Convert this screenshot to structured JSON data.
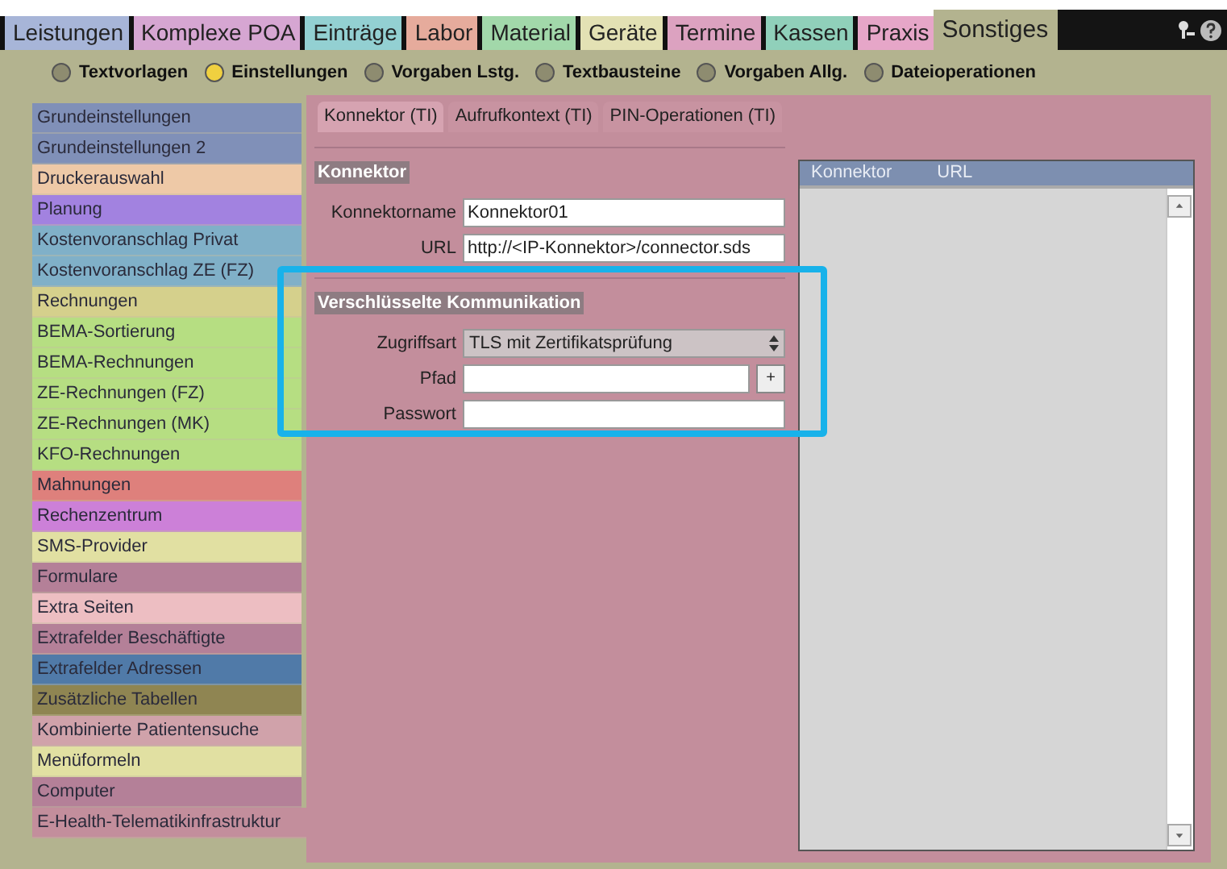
{
  "top_tabs": [
    {
      "label": "Leistungen",
      "color": "#a7b5d8",
      "selected": false
    },
    {
      "label": "Komplexe POA",
      "color": "#d6a6d2",
      "selected": false
    },
    {
      "label": "Einträge",
      "color": "#93d0d2",
      "selected": false
    },
    {
      "label": "Labor",
      "color": "#e6ab9c",
      "selected": false
    },
    {
      "label": "Material",
      "color": "#a2d8aa",
      "selected": false
    },
    {
      "label": "Geräte",
      "color": "#e3e1b4",
      "selected": false
    },
    {
      "label": "Termine",
      "color": "#dca2c0",
      "selected": false
    },
    {
      "label": "Kassen",
      "color": "#90d0ba",
      "selected": false
    },
    {
      "label": "Praxis",
      "color": "#e6a6c8",
      "selected": false
    },
    {
      "label": "Sonstiges",
      "color": "#b3b38f",
      "selected": true
    }
  ],
  "radio_options": [
    {
      "label": "Textvorlagen",
      "selected": false
    },
    {
      "label": "Einstellungen",
      "selected": true
    },
    {
      "label": "Vorgaben Lstg.",
      "selected": false
    },
    {
      "label": "Textbausteine",
      "selected": false
    },
    {
      "label": "Vorgaben Allg.",
      "selected": false
    },
    {
      "label": "Dateioperationen",
      "selected": false
    }
  ],
  "sidebar": {
    "items": [
      {
        "label": "Grundeinstellungen",
        "color": "#8090b8",
        "selected": false
      },
      {
        "label": "Grundeinstellungen 2",
        "color": "#8090b8",
        "selected": false
      },
      {
        "label": "Druckerauswahl",
        "color": "#eec9a7",
        "selected": false
      },
      {
        "label": "Planung",
        "color": "#a282e0",
        "selected": false
      },
      {
        "label": "Kostenvoranschlag Privat",
        "color": "#80b0c8",
        "selected": false
      },
      {
        "label": "Kostenvoranschlag ZE (FZ)",
        "color": "#80b0c8",
        "selected": false
      },
      {
        "label": "Rechnungen",
        "color": "#d5d08c",
        "selected": false
      },
      {
        "label": "BEMA-Sortierung",
        "color": "#b6de82",
        "selected": false
      },
      {
        "label": "BEMA-Rechnungen",
        "color": "#b6de82",
        "selected": false
      },
      {
        "label": "ZE-Rechnungen (FZ)",
        "color": "#b6de82",
        "selected": false
      },
      {
        "label": "ZE-Rechnungen (MK)",
        "color": "#b6de82",
        "selected": false
      },
      {
        "label": "KFO-Rechnungen",
        "color": "#b6de82",
        "selected": false
      },
      {
        "label": "Mahnungen",
        "color": "#de807c",
        "selected": false
      },
      {
        "label": "Rechenzentrum",
        "color": "#cc80d8",
        "selected": false
      },
      {
        "label": "SMS-Provider",
        "color": "#e1e0a2",
        "selected": false
      },
      {
        "label": "Formulare",
        "color": "#b48098",
        "selected": false
      },
      {
        "label": "Extra Seiten",
        "color": "#edbec2",
        "selected": false
      },
      {
        "label": "Extrafelder Beschäftigte",
        "color": "#b48098",
        "selected": false
      },
      {
        "label": "Extrafelder Adressen",
        "color": "#507aa8",
        "selected": false
      },
      {
        "label": "Zusätzliche Tabellen",
        "color": "#8f8552",
        "selected": false
      },
      {
        "label": "Kombinierte Patientensuche",
        "color": "#d0a2aa",
        "selected": false
      },
      {
        "label": "Menüformeln",
        "color": "#e1e0a2",
        "selected": false
      },
      {
        "label": "Computer",
        "color": "#b48098",
        "selected": false
      },
      {
        "label": "E-Health-Telematikinfrastruktur",
        "color": "#c38e9c",
        "selected": true
      }
    ]
  },
  "sub_tabs": [
    {
      "label": "Konnektor (TI)",
      "selected": true
    },
    {
      "label": "Aufrufkontext (TI)",
      "selected": false
    },
    {
      "label": "PIN-Operationen (TI)",
      "selected": false
    }
  ],
  "konnektor": {
    "title": "Konnektor",
    "fields": [
      {
        "label": "Konnektorname",
        "value": "Konnektor01"
      },
      {
        "label": "URL",
        "value": "http://<IP-Konnektor>/connector.sds"
      }
    ]
  },
  "encryption": {
    "title": "Verschlüsselte Kommunikation",
    "access_type": {
      "label": "Zugriffsart",
      "value": "TLS mit Zertifikatsprüfung"
    },
    "path": {
      "label": "Pfad",
      "button": "+"
    },
    "password": {
      "label": "Passwort"
    }
  },
  "connector_table": {
    "columns": [
      "Konnektor",
      "URL"
    ]
  }
}
